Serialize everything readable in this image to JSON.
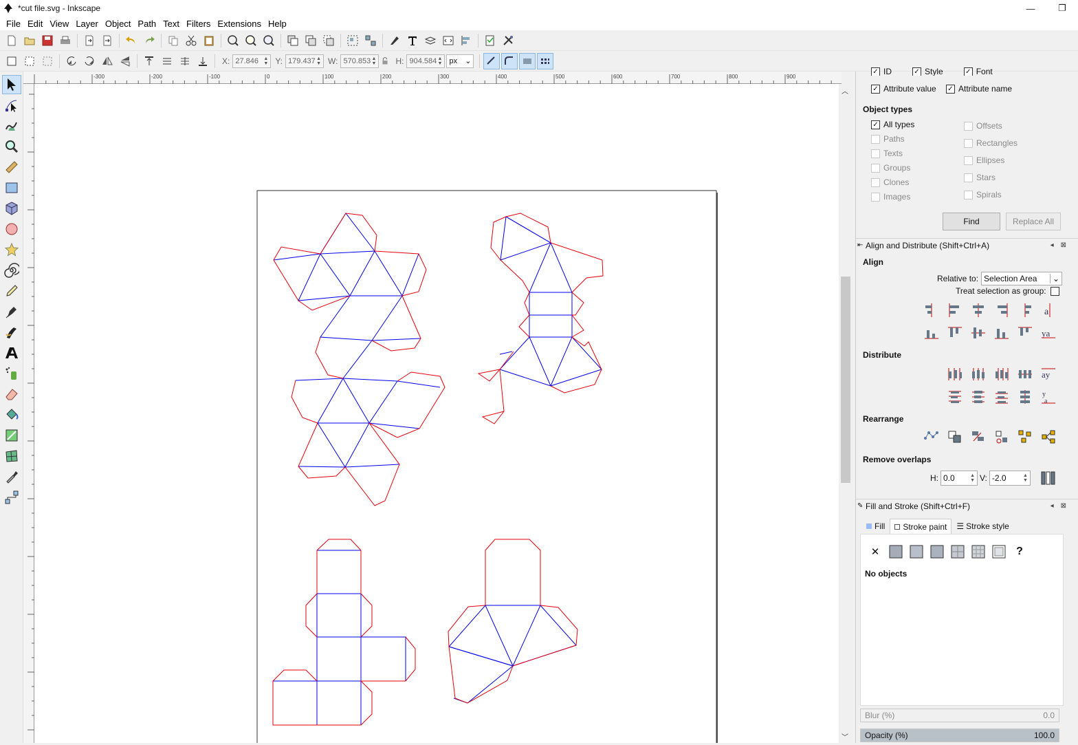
{
  "window": {
    "title": "*cut file.svg - Inkscape",
    "minimize": "—",
    "restore": "❐"
  },
  "menu": [
    "File",
    "Edit",
    "View",
    "Layer",
    "Object",
    "Path",
    "Text",
    "Filters",
    "Extensions",
    "Help"
  ],
  "selector_toolbar": {
    "x_label": "X:",
    "x_value": "27.846",
    "y_label": "Y:",
    "y_value": "179.437",
    "w_label": "W:",
    "w_value": "570.853",
    "h_label": "H:",
    "h_value": "904.584",
    "unit": "px"
  },
  "ruler_ticks": [
    "-300",
    "-200",
    "-100",
    "0",
    "100",
    "200",
    "300",
    "400",
    "500",
    "600",
    "700",
    "800",
    "900"
  ],
  "find_panel": {
    "partial_row": [
      "ID",
      "Style",
      "Font"
    ],
    "attribute_value": "Attribute value",
    "attribute_name": "Attribute name",
    "object_types_heading": "Object types",
    "all_types": "All types",
    "types_left": [
      "Paths",
      "Texts",
      "Groups",
      "Clones",
      "Images"
    ],
    "types_right": [
      "Offsets",
      "Rectangles",
      "Ellipses",
      "Stars",
      "Spirals"
    ],
    "find_button": "Find",
    "replace_all_button": "Replace All"
  },
  "align_panel": {
    "title": "Align and Distribute (Shift+Ctrl+A)",
    "align_heading": "Align",
    "relative_to_label": "Relative to:",
    "relative_to_value": "Selection Area",
    "treat_as_group_label": "Treat selection as group:",
    "distribute_heading": "Distribute",
    "rearrange_heading": "Rearrange",
    "remove_overlaps_heading": "Remove overlaps",
    "h_label": "H:",
    "h_value": "0.0",
    "v_label": "V:",
    "v_value": "-2.0"
  },
  "fill_stroke_panel": {
    "title": "Fill and Stroke (Shift+Ctrl+F)",
    "tabs": [
      "Fill",
      "Stroke paint",
      "Stroke style"
    ],
    "no_objects": "No objects",
    "no_paint_glyph": "✕",
    "unset_glyph": "?",
    "blur_label": "Blur (%)",
    "blur_value": "0.0",
    "opacity_label": "Opacity (%)",
    "opacity_value": "100.0"
  },
  "colors": {
    "cut_line": "#e8000b",
    "fold_line": "#0000ee",
    "selection": "#cde3f7"
  }
}
